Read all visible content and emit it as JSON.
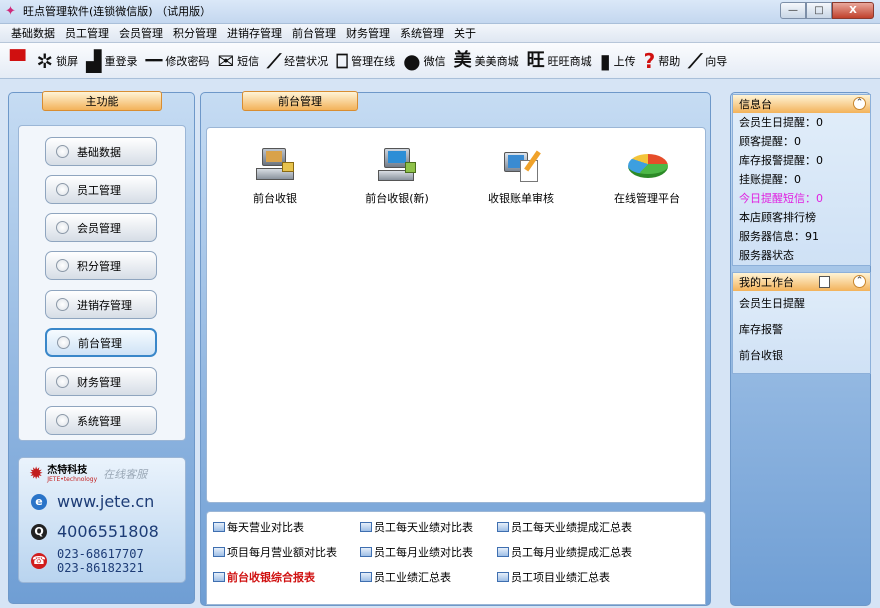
{
  "window": {
    "title": "旺点管理软件(连锁微信版) （试用版）",
    "controls": [
      "—",
      "□",
      "X"
    ]
  },
  "menu": [
    "基础数据",
    "员工管理",
    "会员管理",
    "积分管理",
    "进销存管理",
    "前台管理",
    "财务管理",
    "系统管理",
    "关于"
  ],
  "toolbar": [
    {
      "icon": "monitor-icon",
      "glyph": "▀",
      "label": "",
      "red": true
    },
    {
      "icon": "gear-icon",
      "glyph": "✲",
      "label": "锁屏",
      "red": false
    },
    {
      "icon": "relogin-icon",
      "glyph": "▟",
      "label": "重登录",
      "red": false
    },
    {
      "icon": "key-icon",
      "glyph": "━━",
      "label": "修改密码",
      "red": false
    },
    {
      "icon": "envelope-icon",
      "glyph": "✉",
      "label": "短信",
      "red": false
    },
    {
      "icon": "chart-line-icon",
      "glyph": "⟋",
      "label": "经营状况",
      "red": false
    },
    {
      "icon": "book-icon",
      "glyph": "⎕",
      "label": "管理在线",
      "red": false
    },
    {
      "icon": "wechat-icon",
      "glyph": "●",
      "label": "微信",
      "red": false
    },
    {
      "icon": "meimei-icon",
      "glyph": "美",
      "label": "美美商城",
      "red": false
    },
    {
      "icon": "wangwang-icon",
      "glyph": "旺",
      "label": "旺旺商城",
      "red": false
    },
    {
      "icon": "upload-icon",
      "glyph": "▮",
      "label": "上传",
      "red": false
    },
    {
      "icon": "help-icon",
      "glyph": "?",
      "label": "帮助",
      "red": false
    },
    {
      "icon": "wand-icon",
      "glyph": "⟋",
      "label": "向导",
      "red": false
    }
  ],
  "left_panel": {
    "title": "主功能",
    "buttons": [
      {
        "label": "基础数据",
        "active": false
      },
      {
        "label": "员工管理",
        "active": false
      },
      {
        "label": "会员管理",
        "active": false
      },
      {
        "label": "积分管理",
        "active": false
      },
      {
        "label": "进销存管理",
        "active": false
      },
      {
        "label": "前台管理",
        "active": true
      },
      {
        "label": "财务管理",
        "active": false
      },
      {
        "label": "系统管理",
        "active": false
      }
    ],
    "service": {
      "company": "杰特科技",
      "company_en": "JETE•technology",
      "online": "在线客服",
      "website": "www.jete.cn",
      "hotline": "4006551808",
      "phone1": "023-68617707",
      "phone2": "023-86182321"
    }
  },
  "center_panel": {
    "title": "前台管理",
    "functions": [
      "前台收银",
      "前台收银(新)",
      "收银账单审核",
      "在线管理平台"
    ],
    "reports": [
      {
        "label": "每天营业对比表",
        "bold": false
      },
      {
        "label": "员工每天业绩对比表",
        "bold": false
      },
      {
        "label": "员工每天业绩提成汇总表",
        "bold": false
      },
      {
        "label": "项目每月营业额对比表",
        "bold": false
      },
      {
        "label": "员工每月业绩对比表",
        "bold": false
      },
      {
        "label": "员工每月业绩提成汇总表",
        "bold": false
      },
      {
        "label": "前台收银综合报表",
        "bold": true
      },
      {
        "label": "员工业绩汇总表",
        "bold": false
      },
      {
        "label": "员工项目业绩汇总表",
        "bold": false
      }
    ]
  },
  "info_panel": {
    "title": "信息台",
    "lines": [
      {
        "label": "会员生日提醒：0",
        "pink": false
      },
      {
        "label": "顾客提醒：0",
        "pink": false
      },
      {
        "label": "库存报警提醒：0",
        "pink": false
      },
      {
        "label": "挂账提醒：0",
        "pink": false
      },
      {
        "label": "今日提醒短信：0",
        "pink": true
      },
      {
        "label": "本店顾客排行榜",
        "pink": false
      },
      {
        "label": "服务器信息：91",
        "pink": false
      },
      {
        "label": "服务器状态",
        "pink": false
      }
    ]
  },
  "workbench": {
    "title": "我的工作台",
    "items": [
      "会员生日提醒",
      "库存报警",
      "前台收银"
    ]
  }
}
